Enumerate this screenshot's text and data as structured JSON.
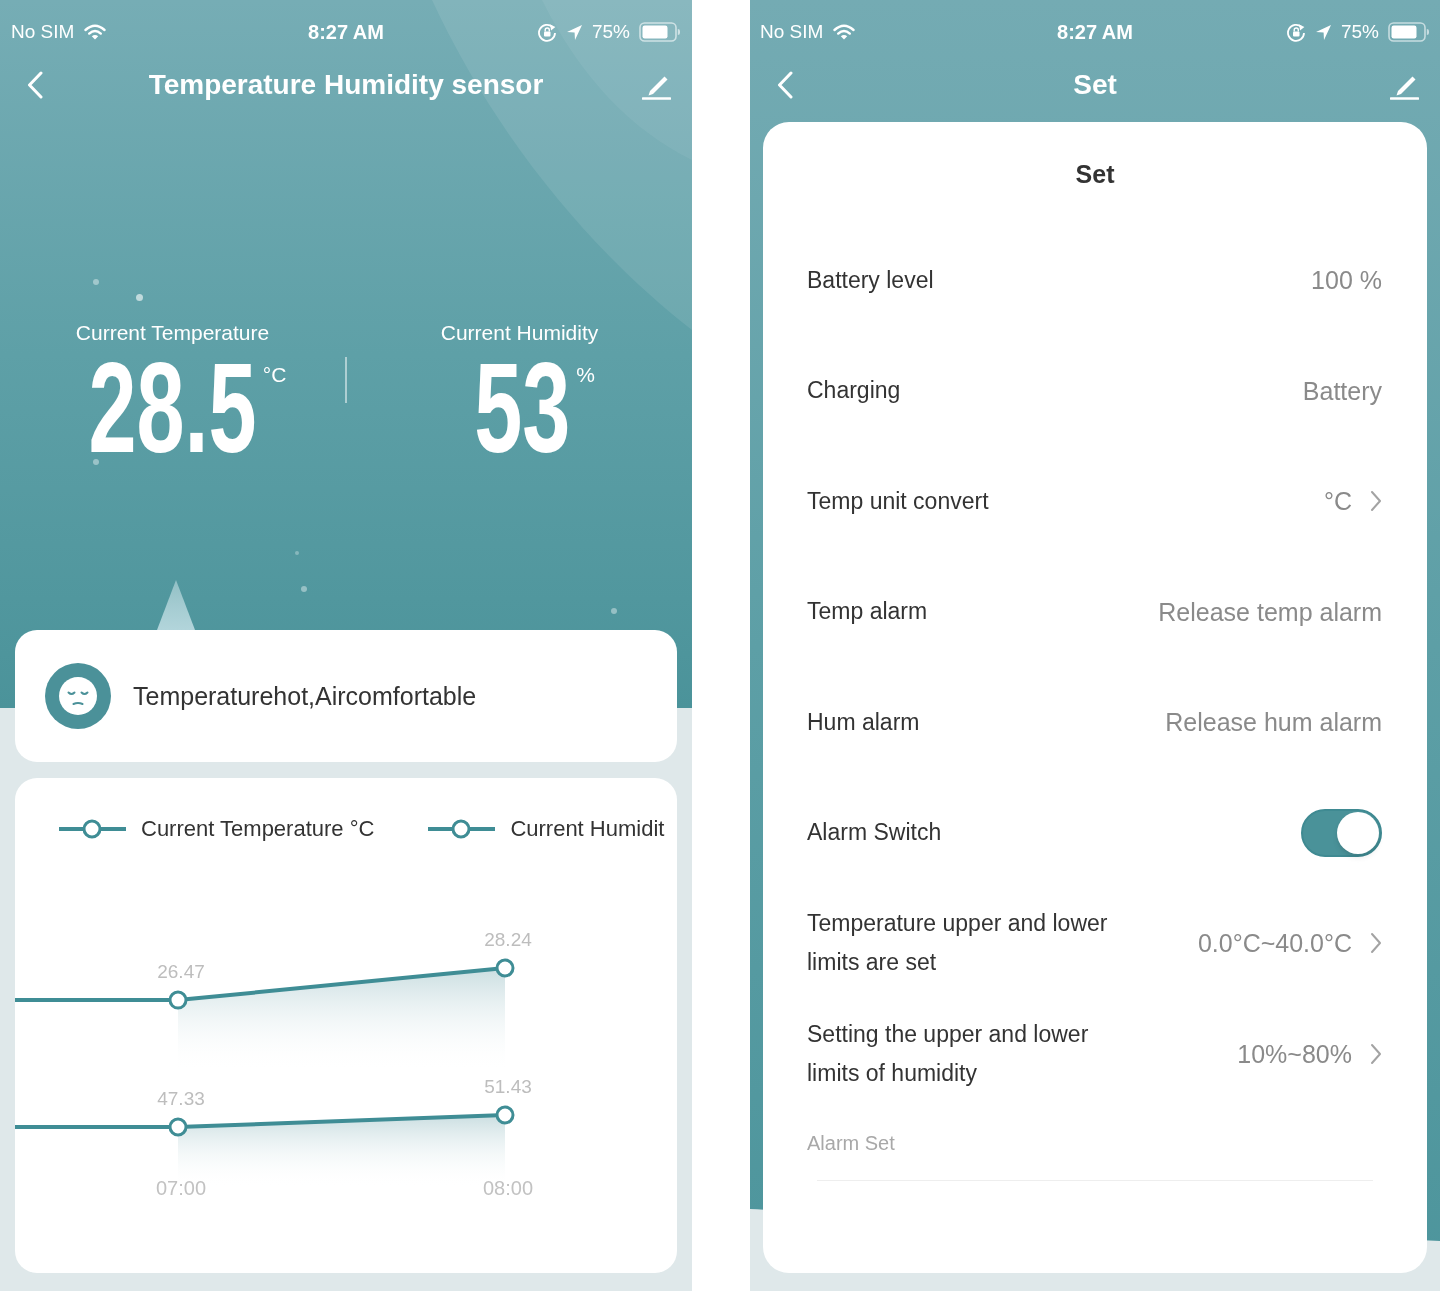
{
  "dashboard": {
    "status_bar": {
      "carrier": "No SIM",
      "time": "8:27 AM",
      "battery": "75%"
    },
    "nav": {
      "title": "Temperature Humidity sensor"
    },
    "readings": [
      {
        "label": "Current Temperature",
        "value": "28.5",
        "unit": "°C"
      },
      {
        "label": "Current Humidity",
        "value": "53",
        "unit": "%"
      }
    ],
    "comfort": {
      "message": "Temperaturehot,Aircomfortable"
    },
    "charts": [
      {
        "chart_data": {
          "type": "area",
          "series": [
            {
              "name": "Current Temperature °C",
              "color": "#3f8d95",
              "marker": "circle",
              "values": [
                26.47,
                28.24
              ]
            }
          ],
          "data_labels": true
        }
      },
      {
        "chart_data": {
          "type": "area",
          "categories": [
            "07:00",
            "08:00"
          ],
          "series": [
            {
              "name": "Current Humidit",
              "color": "#3f8d95",
              "marker": "circle",
              "values": [
                47.33,
                51.43
              ]
            }
          ],
          "data_labels": true
        }
      }
    ]
  },
  "settings": {
    "status_bar": {
      "carrier": "No SIM",
      "time": "8:27 AM",
      "battery": "75%"
    },
    "nav": {
      "title": "Set"
    },
    "card_title": "Set",
    "rows": [
      {
        "kind": "value",
        "label": "Battery level",
        "value": "100 %"
      },
      {
        "kind": "value",
        "label": "Charging",
        "value": "Battery"
      },
      {
        "kind": "link",
        "label": "Temp unit convert",
        "value": "°C"
      },
      {
        "kind": "value",
        "label": "Temp alarm",
        "value": "Release temp alarm"
      },
      {
        "kind": "value",
        "label": "Hum alarm",
        "value": "Release hum alarm"
      },
      {
        "kind": "toggle",
        "label": "Alarm Switch",
        "on": true
      },
      {
        "kind": "link",
        "label": "Temperature upper and lower limits are set",
        "value": "0.0°C~40.0°C"
      },
      {
        "kind": "link",
        "label": "Setting the upper and lower limits of humidity",
        "value": "10%~80%"
      }
    ],
    "section_label": "Alarm Set"
  }
}
